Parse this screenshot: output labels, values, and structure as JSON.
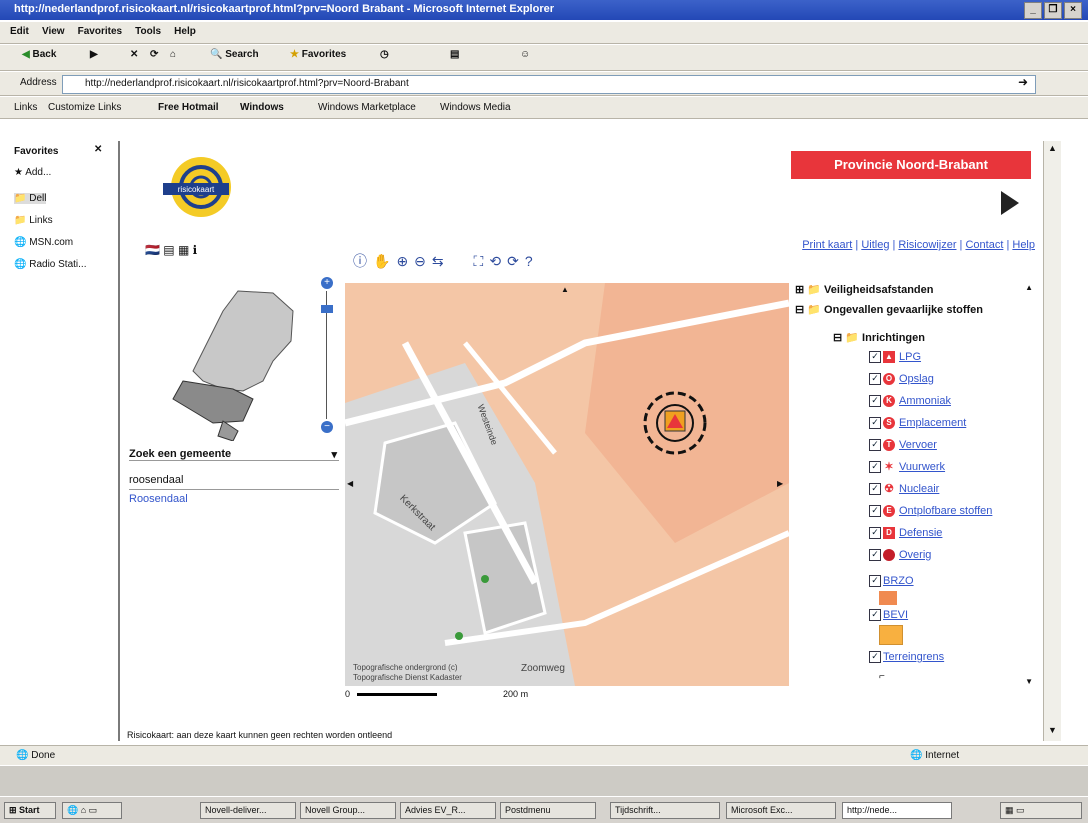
{
  "window": {
    "title": "http://nederlandprof.risicokaart.nl/risicokaartprof.html?prv=Noord Brabant - Microsoft Internet Explorer"
  },
  "menu": {
    "items": [
      "Edit",
      "View",
      "Favorites",
      "Tools",
      "Help"
    ]
  },
  "toolbar": {
    "back": "Back",
    "search": "Search",
    "favorites": "Favorites"
  },
  "address": {
    "label": "Address",
    "url": "http://nederlandprof.risicokaart.nl/risicokaartprof.html?prv=Noord-Brabant"
  },
  "links": {
    "label": "Links",
    "items": [
      "Customize Links",
      "Free Hotmail",
      "Windows",
      "Windows Marketplace",
      "Windows Media"
    ]
  },
  "favorites": {
    "title": "Favorites",
    "add": "Add...",
    "items": [
      "Dell",
      "Links",
      "MSN.com",
      "Radio Stati..."
    ]
  },
  "page": {
    "logo_text": "risicokaart",
    "province_banner": "Provincie Noord-Brabant",
    "top_links": [
      "Print kaart",
      "Uitleg",
      "Risicowijzer",
      "Contact",
      "Help"
    ],
    "search": {
      "label": "Zoek een gemeente",
      "value": "roosendaal",
      "result": "Roosendaal"
    },
    "map_labels": {
      "street1": "Kerkstraat",
      "street2": "Zoomweg",
      "street3": "Westeinde",
      "scale_start": "0",
      "scale_end": "200 m",
      "credit1": "Topografische ondergrond (c)",
      "credit2": "Topografische Dienst Kadaster"
    },
    "layers": {
      "top1": "Veiligheidsafstanden",
      "top2": "Ongevallen gevaarlijke stoffen",
      "group": "Inrichtingen",
      "items": [
        "LPG",
        "Opslag",
        "Ammoniak",
        "Emplacement",
        "Vervoer",
        "Vuurwerk",
        "Nucleair",
        "Ontplofbare stoffen",
        "Defensie",
        "Overig"
      ],
      "extra": [
        "BRZO",
        "BEVI",
        "Terreingrens"
      ]
    },
    "footer_note": "Risicokaart: aan deze kaart kunnen geen rechten worden ontleend"
  },
  "statusbar": {
    "left": "Done",
    "zone": "Internet"
  },
  "taskbar": {
    "start": "Start",
    "tasks": [
      "Novell-deliver...",
      "Novell Group...",
      "Advies EV_R...",
      "Postdmenu",
      "Tijdschrift...",
      "Microsoft Exc...",
      "http://nede..."
    ]
  }
}
